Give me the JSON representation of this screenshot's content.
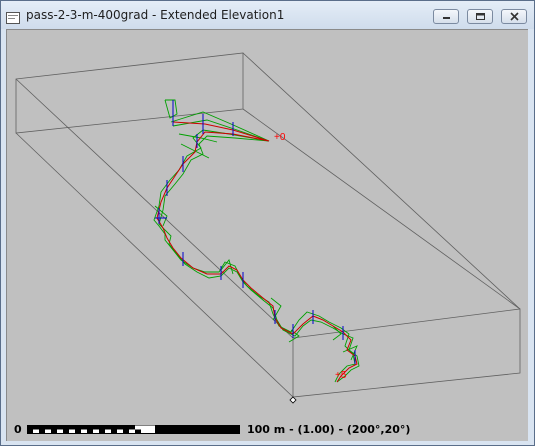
{
  "window": {
    "title": "pass-2-3-m-400grad - Extended Elevation1",
    "icon": "app-document-icon"
  },
  "controls": {
    "minimize_icon": "minimize-icon",
    "maximize_icon": "maximize-icon",
    "close_icon": "close-icon"
  },
  "view": {
    "station_start_label": "+0",
    "station_end_label": "+5",
    "label_color": "#ff0000",
    "passage_color": "#00a000",
    "centerline_color": "#cc0000",
    "station_marker_color": "#0000cc",
    "box_color": "#606060",
    "background_color": "#c0c0c0"
  },
  "scale": {
    "zero_label": "0",
    "description": "100 m - (1.00) - (200°,20°)"
  }
}
